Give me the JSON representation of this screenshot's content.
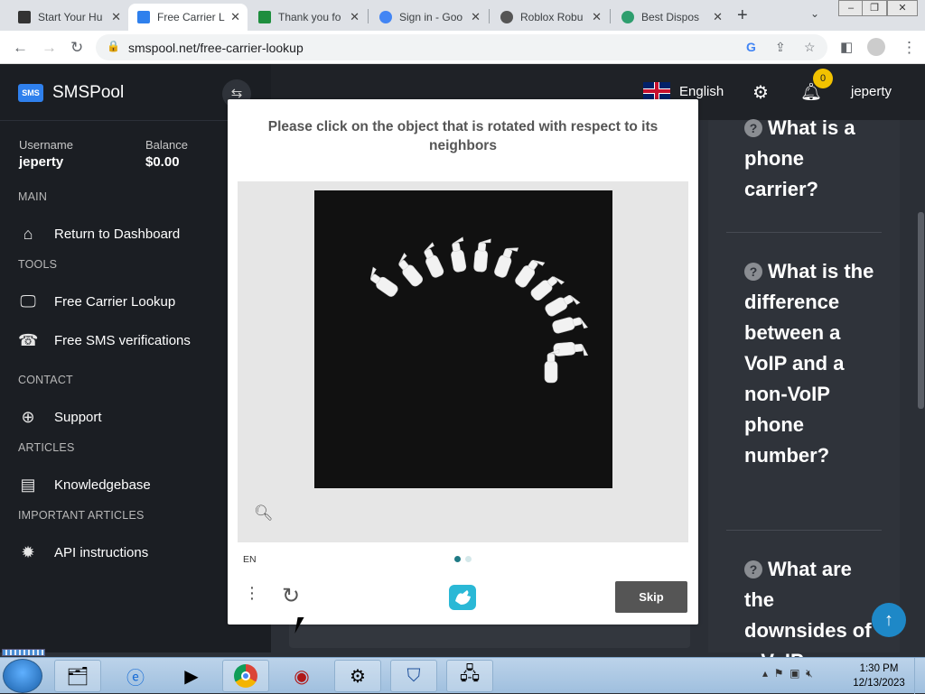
{
  "browser": {
    "tabs": [
      {
        "title": "Start Your Hu",
        "active": false,
        "fav": "#333"
      },
      {
        "title": "Free Carrier L",
        "active": true,
        "fav": "#2f80ed"
      },
      {
        "title": "Thank you fo",
        "active": false,
        "fav": "#1e8e3e"
      },
      {
        "title": "Sign in - Goo",
        "active": false,
        "fav": "#4285f4"
      },
      {
        "title": "Roblox Robu",
        "active": false,
        "fav": "#555"
      },
      {
        "title": "Best Dispos",
        "active": false,
        "fav": "#2e9e6e"
      }
    ],
    "url": "smspool.net/free-carrier-lookup",
    "close_glyph": "✕",
    "newtab_glyph": "+",
    "tabmenu_glyph": "⌄"
  },
  "sidebar": {
    "brand": "SMSPool",
    "logo_text": "SMS",
    "username_label": "Username",
    "username": "jeperty",
    "balance_label": "Balance",
    "balance": "$0.00",
    "sections": {
      "main": "MAIN",
      "tools": "TOOLS",
      "contact": "CONTACT",
      "articles": "ARTICLES",
      "important": "IMPORTANT ARTICLES"
    },
    "items": {
      "dashboard": "Return to Dashboard",
      "carrier": "Free Carrier Lookup",
      "sms": "Free SMS verifications",
      "support": "Support",
      "kb": "Knowledgebase",
      "api": "API instructions"
    }
  },
  "topbar": {
    "language": "English",
    "notifications": "0",
    "user": "jeperty"
  },
  "faq": [
    "What is a phone carrier?",
    "What is the difference between a VoIP and a non-VoIP phone number?",
    "What are the downsides of a VoIP"
  ],
  "captcha": {
    "prompt": "Please click on the object that is rotated with respect to its neighbors",
    "lang": "EN",
    "skip": "Skip"
  },
  "taskbar": {
    "time": "1:30 PM",
    "date": "12/13/2023"
  },
  "colors": {
    "accent": "#2f80ed",
    "sidebar_bg": "#1b1e23",
    "main_bg": "#2b2f36",
    "badge": "#f2c200",
    "skip_bg": "#555555"
  }
}
